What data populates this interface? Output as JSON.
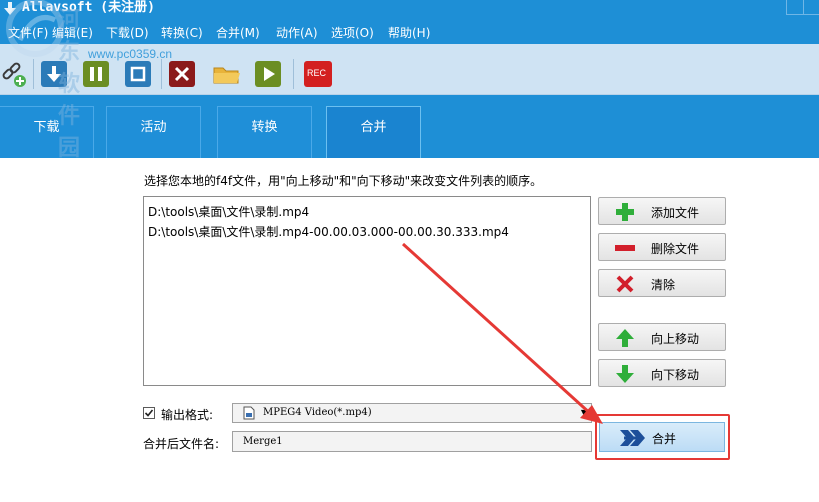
{
  "window": {
    "title": "Allavsoft (未注册)"
  },
  "menu": [
    "文件(F)",
    "编辑(E)",
    "下载(D)",
    "转换(C)",
    "合并(M)",
    "动作(A)",
    "选项(O)",
    "帮助(H)"
  ],
  "toolbar": {
    "rec_label": "REC"
  },
  "tabs": [
    "下载",
    "活动",
    "转换",
    "合并"
  ],
  "active_tab": "合并",
  "instruction": "选择您本地的f4f文件，用\"向上移动\"和\"向下移动\"来改变文件列表的顺序。",
  "files": [
    "D:\\tools\\桌面\\文件\\录制.mp4",
    "D:\\tools\\桌面\\文件\\录制.mp4-00.00.03.000-00.00.30.333.mp4"
  ],
  "buttons": {
    "add_file": "添加文件",
    "delete_file": "删除文件",
    "clear": "清除",
    "move_up": "向上移动",
    "move_down": "向下移动",
    "merge": "合并"
  },
  "output_format": {
    "label": "输出格式:",
    "checked": true,
    "value": "MPEG4 Video(*.mp4)"
  },
  "merged_filename": {
    "label": "合并后文件名:",
    "value": "Merge1"
  },
  "watermark": {
    "name": "河东软件园",
    "url": "www.pc0359.cn"
  },
  "colors": {
    "accent": "#1e8fd6",
    "annotation": "#e53935"
  }
}
